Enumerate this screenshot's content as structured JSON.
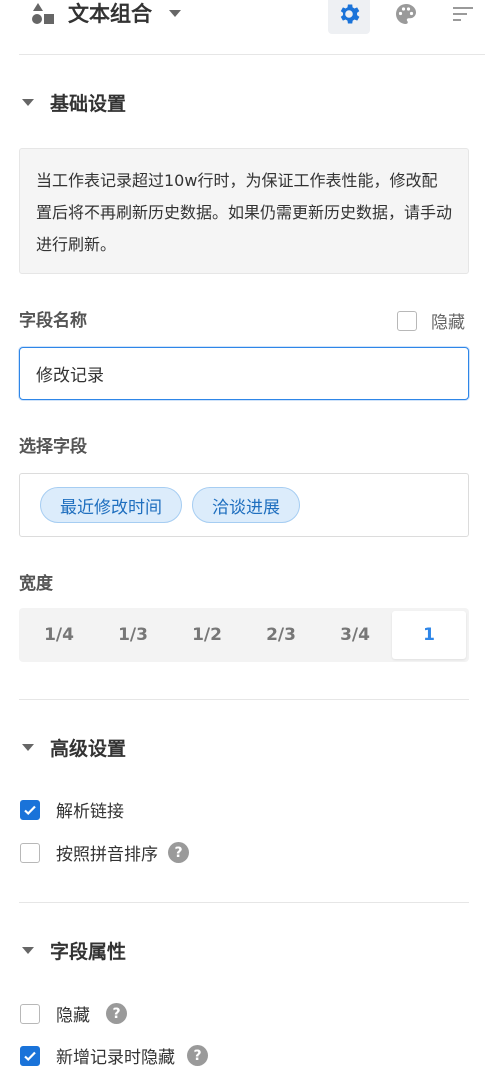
{
  "header": {
    "title": "文本组合",
    "icons": [
      "shapes-icon",
      "chevron-down-icon",
      "gear-icon",
      "palette-icon",
      "sort-icon"
    ],
    "accent": "#1a73d9"
  },
  "basic": {
    "title": "基础设置",
    "notice": "当工作表记录超过10w行时，为保证工作表性能，修改配置后将不再刷新历史数据。如果仍需更新历史数据，请手动进行刷新。",
    "field_name_label": "字段名称",
    "hide_label": "隐藏",
    "field_name_value": "修改记录",
    "select_field_label": "选择字段",
    "tags": [
      "最近修改时间",
      "洽谈进展"
    ],
    "width_label": "宽度",
    "width_options": [
      "1/4",
      "1/3",
      "1/2",
      "2/3",
      "3/4",
      "1"
    ],
    "width_selected": "1"
  },
  "advanced": {
    "title": "高级设置",
    "parse_link": "解析链接",
    "parse_link_checked": true,
    "pinyin_sort": "按照拼音排序",
    "pinyin_sort_checked": false
  },
  "attributes": {
    "title": "字段属性",
    "hide": "隐藏",
    "hide_checked": false,
    "hide_on_create": "新增记录时隐藏",
    "hide_on_create_checked": true
  }
}
